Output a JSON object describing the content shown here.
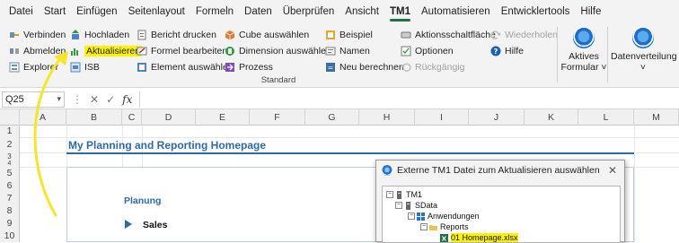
{
  "menubar": {
    "tabs": [
      "Datei",
      "Start",
      "Einfügen",
      "Seitenlayout",
      "Formeln",
      "Daten",
      "Überprüfen",
      "Ansicht",
      "TM1",
      "Automatisieren",
      "Entwicklertools",
      "Hilfe"
    ],
    "active_tab": "TM1"
  },
  "ribbon": {
    "col1": [
      "Verbinden",
      "Abmelden",
      "Explorer"
    ],
    "col2": [
      "Hochladen",
      "Aktualisieren",
      "ISB"
    ],
    "col3": [
      "Bericht drucken",
      "Formel bearbeiten",
      "Element auswählen"
    ],
    "col4": [
      "Cube auswählen",
      "Dimension auswählen",
      "Prozess"
    ],
    "col5": [
      "Beispiel",
      "Namen",
      "Neu berechnen"
    ],
    "col6": [
      "Aktionsschaltfläche",
      "Optionen",
      "Rückgängig"
    ],
    "col7": [
      "Wiederholen",
      "Hilfe"
    ],
    "group_label": "Standard",
    "big_buttons": {
      "aktives_formular_line1": "Aktives",
      "aktives_formular_line2": "Formular",
      "datenverteilung": "Datenverteilung"
    }
  },
  "formula_bar": {
    "name_box": "Q25",
    "fx": "fx",
    "cancel": "✕",
    "confirm": "✓",
    "value": ""
  },
  "columns": [
    "A",
    "B",
    "C",
    "D",
    "E",
    "F",
    "G",
    "H",
    "I",
    "J",
    "K",
    "L",
    "M"
  ],
  "rows": [
    "1",
    "2",
    "3",
    "4",
    "5",
    "6",
    "7",
    "8",
    "9",
    "10"
  ],
  "sheet": {
    "title": "My Planning and Reporting Homepage",
    "planung": "Planung",
    "sales": "Sales"
  },
  "dialog": {
    "title": "Externe TM1 Datei zum Aktualisieren auswählen",
    "tree": {
      "root": "TM1",
      "server": "SData",
      "apps": "Anwendungen",
      "reports": "Reports",
      "file": "01 Homepage.xlsx"
    }
  },
  "colors": {
    "accent": "#1f7145",
    "title_blue": "#2e6aa8",
    "highlight": "#fff200",
    "annotation_arrow": "#f5e62a"
  }
}
